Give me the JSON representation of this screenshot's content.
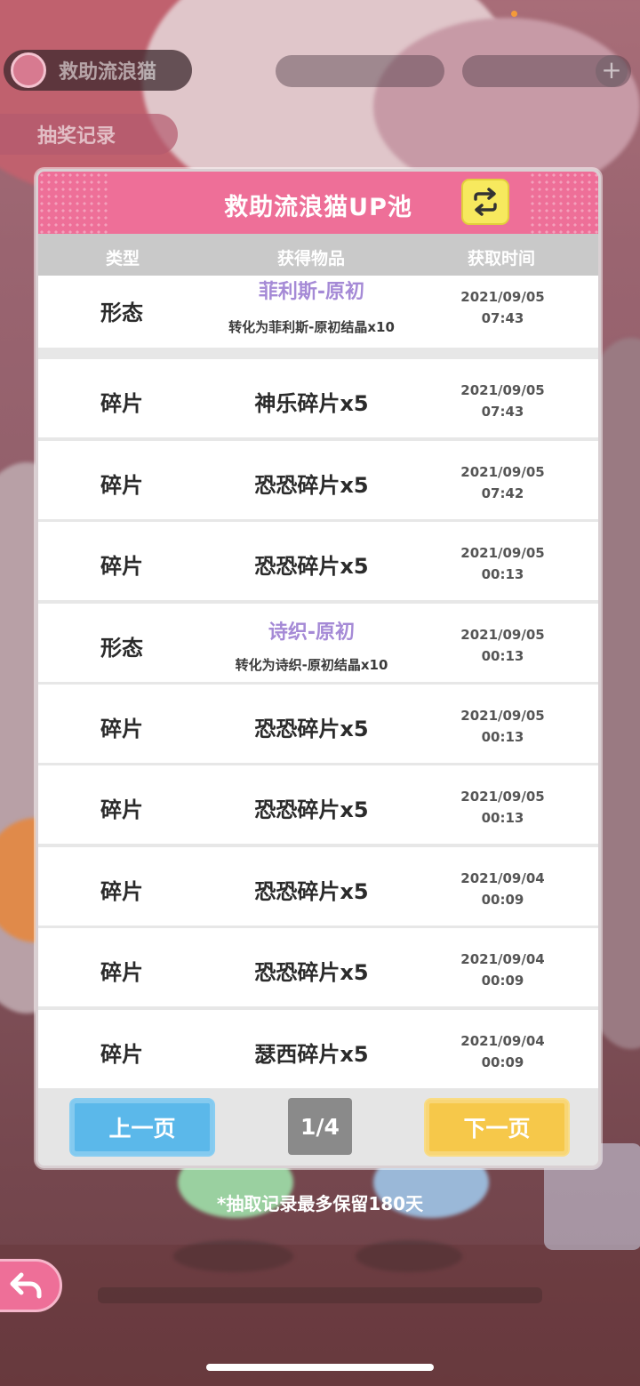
{
  "background": {
    "top_pill_label": "救助流浪猫",
    "sub_pill_label": "抽奖记录"
  },
  "modal": {
    "title": "救助流浪猫UP池",
    "swap_icon": "swap-arrows-icon",
    "columns": {
      "type": "类型",
      "item": "获得物品",
      "time": "获取时间"
    },
    "rows": [
      {
        "type": "形态",
        "item": "菲利斯-原初",
        "note": "转化为菲利斯-原初结晶x10",
        "date": "2021/09/05",
        "time": "07:43",
        "highlight": true
      },
      {
        "type": "碎片",
        "item": "神乐碎片x5",
        "date": "2021/09/05",
        "time": "07:43"
      },
      {
        "type": "碎片",
        "item": "恐恐碎片x5",
        "date": "2021/09/05",
        "time": "07:42"
      },
      {
        "type": "碎片",
        "item": "恐恐碎片x5",
        "date": "2021/09/05",
        "time": "00:13"
      },
      {
        "type": "形态",
        "item": "诗织-原初",
        "note": "转化为诗织-原初结晶x10",
        "date": "2021/09/05",
        "time": "00:13",
        "highlight": true
      },
      {
        "type": "碎片",
        "item": "恐恐碎片x5",
        "date": "2021/09/05",
        "time": "00:13"
      },
      {
        "type": "碎片",
        "item": "恐恐碎片x5",
        "date": "2021/09/05",
        "time": "00:13"
      },
      {
        "type": "碎片",
        "item": "恐恐碎片x5",
        "date": "2021/09/04",
        "time": "00:09"
      },
      {
        "type": "碎片",
        "item": "恐恐碎片x5",
        "date": "2021/09/04",
        "time": "00:09"
      },
      {
        "type": "碎片",
        "item": "瑟西碎片x5",
        "date": "2021/09/04",
        "time": "00:09"
      }
    ],
    "pagination": {
      "prev_label": "上一页",
      "page_indicator": "1/4",
      "next_label": "下一页"
    }
  },
  "retention_note": "*抽取记录最多保留180天",
  "colors": {
    "header_pink": "#ee6f98",
    "prev_blue": "#5bb8ea",
    "next_yellow": "#f6c84a",
    "highlight_purple": "#a58ad6"
  }
}
